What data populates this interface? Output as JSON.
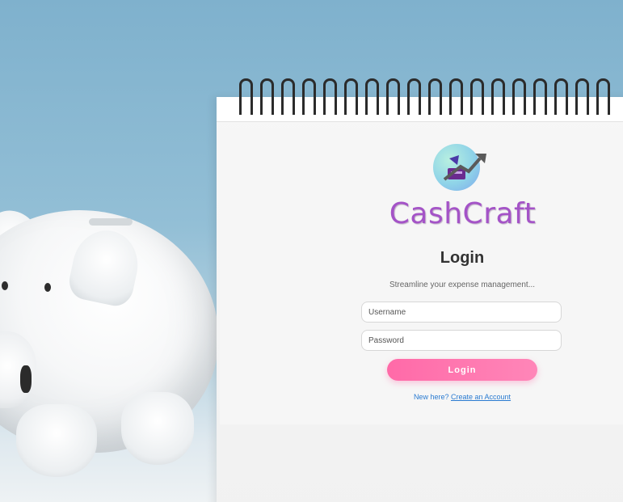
{
  "app": {
    "brand": "CashCraft"
  },
  "login": {
    "title": "Login",
    "subtitle": "Streamline your expense management...",
    "username_placeholder": "Username",
    "password_placeholder": "Password",
    "submit_label": "Login",
    "signup_prompt": "New here?",
    "signup_link": "Create an Account"
  },
  "colors": {
    "brand": "#a453c7",
    "button": "#ff6aa8",
    "link": "#2a7bd1",
    "background": "#8fbcd4"
  },
  "icons": [
    "cashcraft-logo-icon",
    "piggy-bank-image",
    "calendar-rings"
  ]
}
